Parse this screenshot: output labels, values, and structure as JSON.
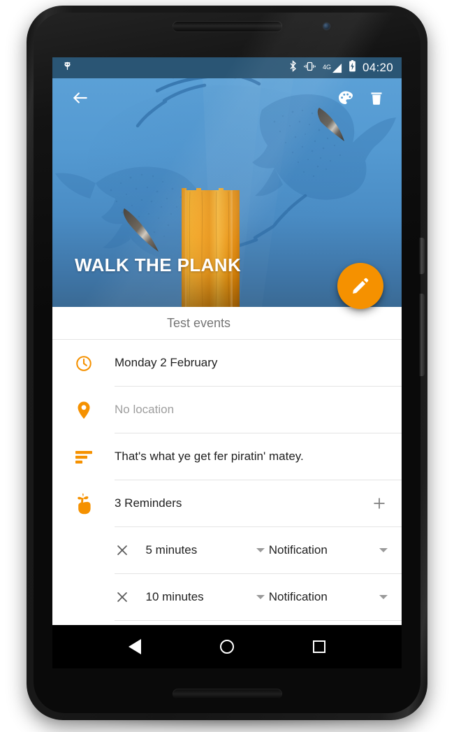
{
  "device": {
    "name": "android-phone"
  },
  "status_bar": {
    "app_icon": "android-bug-icon",
    "icons": [
      "bluetooth-icon",
      "vibrate-icon",
      "signal-4g-icon",
      "battery-charging-icon"
    ],
    "network_label": "4G",
    "clock": "04:20",
    "background_color": "#2a5574"
  },
  "app_bar": {
    "back_label": "back-arrow",
    "palette_label": "palette",
    "delete_label": "delete"
  },
  "hero": {
    "title": "WALK THE PLANK",
    "illustration": "sharks-circling-a-plank-underwater",
    "gradient_top": "#5ba0d6",
    "gradient_bottom": "#3a6a94",
    "plank_color": "#f5a623"
  },
  "fab": {
    "icon": "edit-pencil-icon",
    "color": "#f59100"
  },
  "event": {
    "title_value": "",
    "title_placeholder": "Test events",
    "accent_color": "#f59100",
    "rows": [
      {
        "icon": "clock-icon",
        "text": "Monday 2 February",
        "muted": false
      },
      {
        "icon": "location-pin-icon",
        "text": "No location",
        "muted": true
      },
      {
        "icon": "description-icon",
        "text": "That's what ye get fer piratin' matey.",
        "muted": false
      }
    ],
    "reminders_row": {
      "icon": "reminder-finger-bow-icon",
      "text": "3 Reminders",
      "add_label": "+"
    },
    "reminders": [
      {
        "remove_label": "×",
        "when": "5 minutes",
        "kind": "Notification"
      },
      {
        "remove_label": "×",
        "when": "10 minutes",
        "kind": "Notification"
      }
    ]
  },
  "nav_bar": {
    "back": "back-triangle-icon",
    "home": "home-circle-icon",
    "recents": "recents-square-icon"
  }
}
